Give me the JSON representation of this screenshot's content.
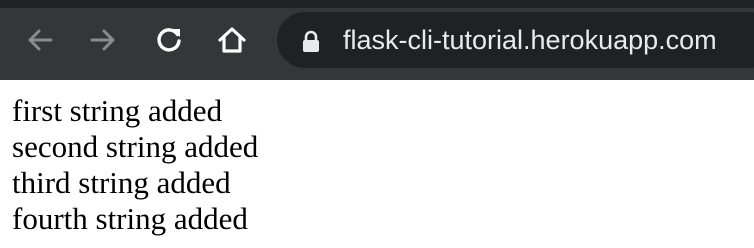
{
  "browser": {
    "address_bar": {
      "url": "flask-cli-tutorial.herokuapp.com",
      "icon": "lock-icon"
    },
    "nav": {
      "back_icon": "arrow-left-icon",
      "forward_icon": "arrow-right-icon",
      "reload_icon": "reload-icon",
      "home_icon": "home-icon"
    },
    "colors": {
      "toolbar": "#35363a",
      "omnibox": "#202124",
      "icon_active": "#ffffff",
      "icon_disabled": "#8a8b8e"
    }
  },
  "page": {
    "lines": [
      "first string added",
      "second string added",
      "third string added",
      "fourth string added"
    ]
  }
}
